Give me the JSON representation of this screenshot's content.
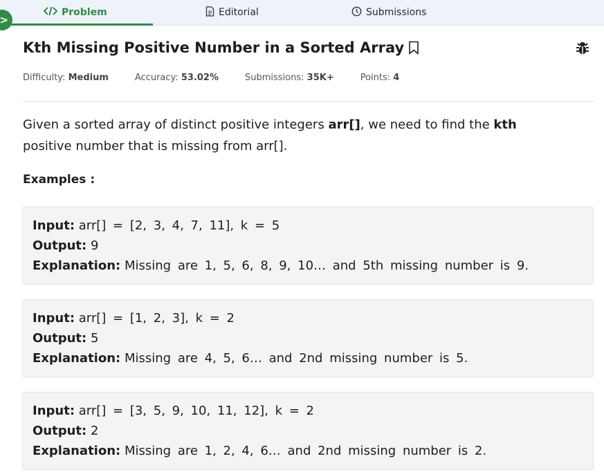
{
  "tabs": [
    {
      "label": "Problem",
      "icon": "code-icon",
      "active": true
    },
    {
      "label": "Editorial",
      "icon": "document-icon",
      "active": false
    },
    {
      "label": "Submissions",
      "icon": "clock-icon",
      "active": false
    }
  ],
  "problem": {
    "title": "Kth Missing Positive Number in a Sorted Array",
    "meta": {
      "difficulty_label": "Difficulty:",
      "difficulty_value": "Medium",
      "accuracy_label": "Accuracy:",
      "accuracy_value": "53.02%",
      "submissions_label": "Submissions:",
      "submissions_value": "35K+",
      "points_label": "Points:",
      "points_value": "4"
    },
    "description": {
      "part1": "Given a sorted array of distinct positive integers ",
      "bold1": "arr[]",
      "part2": ", we need to find the ",
      "bold2": "kth",
      "part3": " positive number that is missing from arr[]."
    },
    "examples_title": "Examples :",
    "examples": [
      {
        "input_label": "Input:",
        "input_value": "arr[] = [2, 3, 4, 7, 11], k = 5",
        "output_label": "Output:",
        "output_value": "9",
        "explanation_label": "Explanation:",
        "explanation_value": "Missing are 1, 5, 6, 8, 9, 10… and 5th missing number is 9."
      },
      {
        "input_label": "Input:",
        "input_value": "arr[] = [1, 2, 3], k = 2",
        "output_label": "Output:",
        "output_value": "5",
        "explanation_label": "Explanation:",
        "explanation_value": "Missing are 4, 5, 6… and 2nd missing number is 5."
      },
      {
        "input_label": "Input:",
        "input_value": "arr[] = [3, 5, 9, 10, 11, 12], k = 2",
        "output_label": "Output:",
        "output_value": "2",
        "explanation_label": "Explanation:",
        "explanation_value": "Missing are 1, 2, 4, 6… and 2nd missing number is 2."
      }
    ]
  },
  "colors": {
    "accent": "#2f8d46",
    "tabbar_bg": "#eef3fa",
    "example_bg": "#f4f4f4"
  }
}
